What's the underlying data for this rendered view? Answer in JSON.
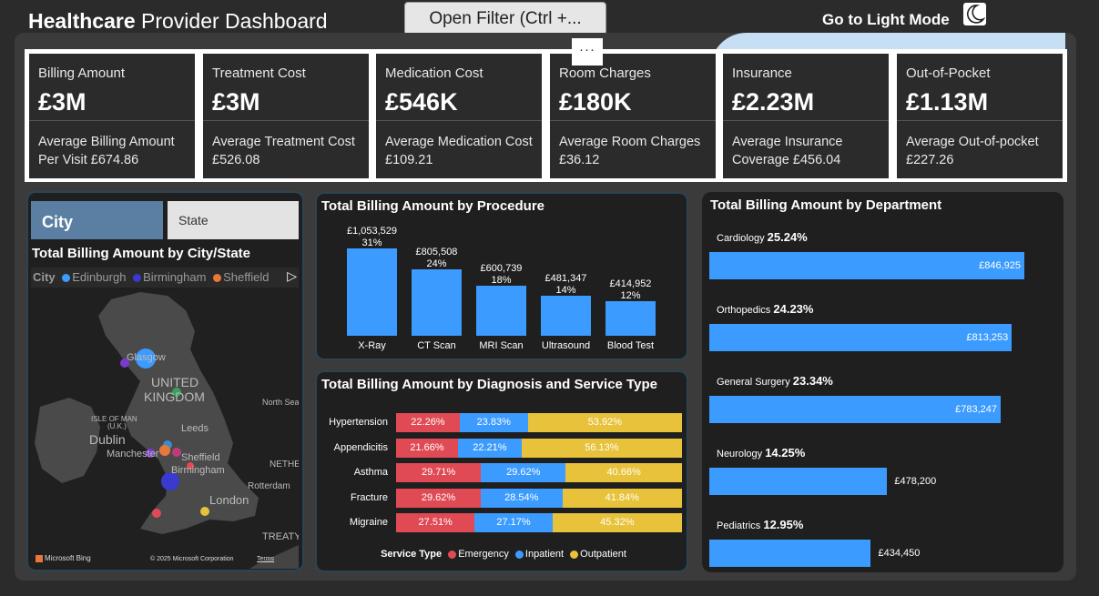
{
  "header": {
    "title_bold": "Healthcare",
    "title_rest": " Provider Dashboard",
    "filter_button": "Open Filter (Ctrl +...",
    "more_options": "···",
    "light_mode": "Go to Light Mode",
    "light_mode_icon": "moon-icon"
  },
  "kpis": [
    {
      "label": "Billing Amount",
      "value": "£3M",
      "avg": "Average Billing Amount Per Visit £674.86"
    },
    {
      "label": "Treatment Cost",
      "value": "£3M",
      "avg": "Average Treatment Cost £526.08"
    },
    {
      "label": "Medication Cost",
      "value": "£546K",
      "avg": "Average Medication Cost £109.21"
    },
    {
      "label": "Room Charges",
      "value": "£180K",
      "avg": "Average Room Charges £36.12"
    },
    {
      "label": "Insurance",
      "value": "£2.23M",
      "avg": "Average Insurance Coverage £456.04"
    },
    {
      "label": "Out-of-Pocket",
      "value": "£1.13M",
      "avg": "Average Out-of-pocket £227.26"
    }
  ],
  "map_panel": {
    "slicer_city": "City",
    "slicer_state": "State",
    "title": "Total Billing Amount by City/State",
    "legend_title": "City",
    "legend": [
      {
        "name": "Edinburgh",
        "color": "#3b9bff"
      },
      {
        "name": "Birmingham",
        "color": "#3a3ad0"
      },
      {
        "name": "Sheffield",
        "color": "#e8773a"
      }
    ],
    "labels": {
      "glasgow": "Glasgow",
      "uk1": "UNITED",
      "uk2": "KINGDOM",
      "isle1": "ISLE OF MAN",
      "isle2": "(U.K.)",
      "dublin": "Dublin",
      "manchester": "Manchester",
      "leeds": "Leeds",
      "sheffield": "Sheffield",
      "birmingham": "Birmingham",
      "london": "London",
      "northsea": "North Sea",
      "neth": "NETHE",
      "rotterdam": "Rotterdam",
      "treaty": "TREATY",
      "bing": "Microsoft Bing",
      "copyright": "© 2025 Microsoft Corporation",
      "terms": "Terms"
    }
  },
  "procedure_panel": {
    "title": "Total Billing Amount by Procedure"
  },
  "diagnosis_panel": {
    "title": "Total Billing Amount by Diagnosis and Service Type",
    "legend_title": "Service Type"
  },
  "department_panel": {
    "title": "Total Billing Amount by Department"
  },
  "chart_data": [
    {
      "type": "bar",
      "title": "Total Billing Amount by Procedure",
      "categories": [
        "X-Ray",
        "CT Scan",
        "MRI Scan",
        "Ultrasound",
        "Blood Test"
      ],
      "values": [
        1053529,
        805508,
        600739,
        481347,
        414952
      ],
      "value_labels": [
        "£1,053,529",
        "£805,508",
        "£600,739",
        "£481,347",
        "£414,952"
      ],
      "percent_labels": [
        "31%",
        "24%",
        "18%",
        "14%",
        "12%"
      ],
      "color": "#3b9bff"
    },
    {
      "type": "bar",
      "orientation": "horizontal",
      "stacked": "100%",
      "title": "Total Billing Amount by Diagnosis and Service Type",
      "categories": [
        "Hypertension",
        "Appendicitis",
        "Asthma",
        "Fracture",
        "Migraine"
      ],
      "series": [
        {
          "name": "Emergency",
          "color": "#e04a55",
          "values": [
            22.26,
            21.66,
            29.71,
            29.62,
            27.51
          ],
          "labels": [
            "22.26%",
            "21.66%",
            "29.71%",
            "29.62%",
            "27.51%"
          ]
        },
        {
          "name": "Inpatient",
          "color": "#3b9bff",
          "values": [
            23.83,
            22.21,
            29.62,
            28.54,
            27.17
          ],
          "labels": [
            "23.83%",
            "22.21%",
            "29.62%",
            "28.54%",
            "27.17%"
          ]
        },
        {
          "name": "Outpatient",
          "color": "#e8c23a",
          "values": [
            53.92,
            56.13,
            40.66,
            41.84,
            45.32
          ],
          "labels": [
            "53.92%",
            "56.13%",
            "40.66%",
            "41.84%",
            "45.32%"
          ]
        }
      ],
      "legend": "bottom"
    },
    {
      "type": "bar",
      "orientation": "horizontal",
      "title": "Total Billing Amount by Department",
      "categories": [
        "Cardiology",
        "Orthopedics",
        "General Surgery",
        "Neurology",
        "Pediatrics"
      ],
      "percent_labels": [
        "25.24%",
        "24.23%",
        "23.34%",
        "14.25%",
        "12.95%"
      ],
      "values": [
        846925,
        813253,
        783247,
        478200,
        434450
      ],
      "value_labels": [
        "£846,925",
        "£813,253",
        "£783,247",
        "£478,200",
        "£434,450"
      ],
      "color": "#3b9bff"
    }
  ]
}
